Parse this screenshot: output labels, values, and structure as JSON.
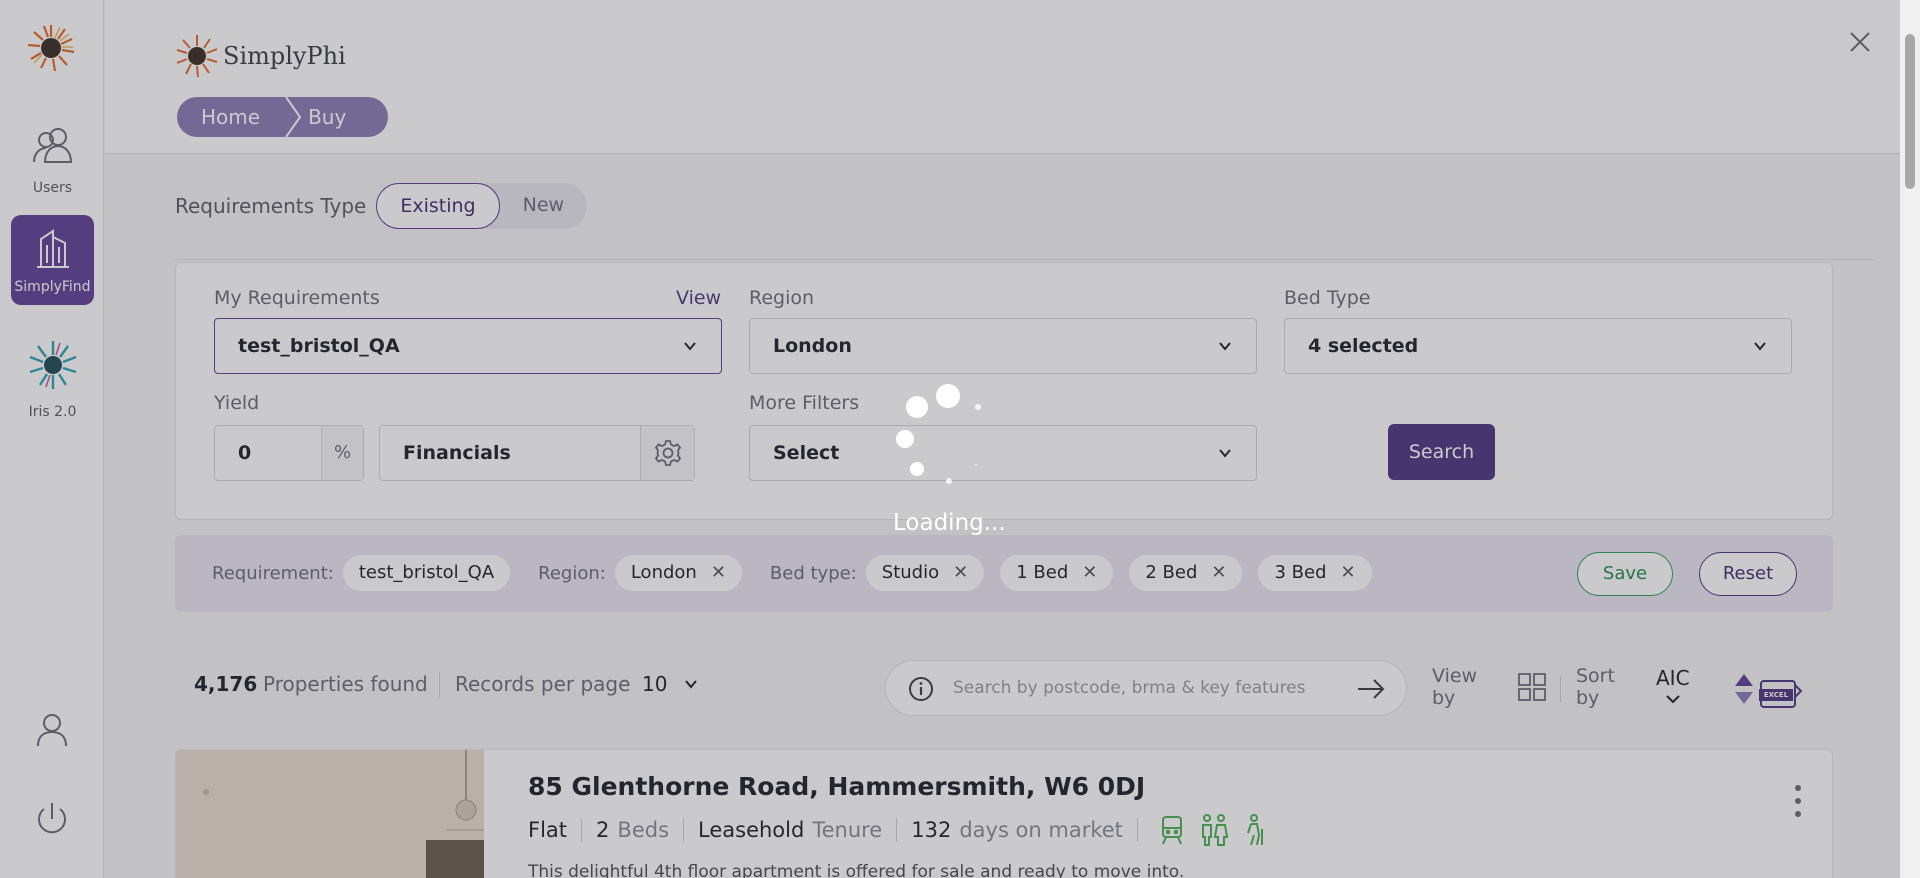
{
  "sidebar": {
    "items": [
      {
        "label": "Users"
      },
      {
        "label": "SimplyFind"
      },
      {
        "label": "Iris 2.0"
      }
    ]
  },
  "header": {
    "brand": "SimplyPhi",
    "breadcrumb": [
      "Home",
      "Buy"
    ]
  },
  "requirements_type": {
    "label": "Requirements Type",
    "options": [
      "Existing",
      "New"
    ],
    "selected": "Existing"
  },
  "filters": {
    "my_requirements": {
      "label": "My Requirements",
      "link": "View",
      "value": "test_bristol_QA"
    },
    "region": {
      "label": "Region",
      "value": "London"
    },
    "bed_type": {
      "label": "Bed Type",
      "value": "4 selected"
    },
    "yield": {
      "label": "Yield",
      "value": "0",
      "unit": "%"
    },
    "financials": {
      "label": "Financials"
    },
    "more_filters": {
      "label": "More Filters",
      "value": "Select"
    },
    "search_button": "Search"
  },
  "active_filters": {
    "requirement_label": "Requirement:",
    "requirement": "test_bristol_QA",
    "region_label": "Region:",
    "region": "London",
    "bed_type_label": "Bed type:",
    "bed_types": [
      "Studio",
      "1 Bed",
      "2 Bed",
      "3 Bed"
    ],
    "save": "Save",
    "reset": "Reset"
  },
  "results": {
    "count": "4,176",
    "count_label": "Properties found",
    "records_per_page_label": "Records per page",
    "records_per_page": "10",
    "search_placeholder": "Search by postcode, brma & key features",
    "view_by": "View by",
    "sort_by": "Sort by",
    "sort_value": "AIC",
    "excel_label": "EXCEL"
  },
  "property": {
    "title": "85 Glenthorne Road, Hammersmith, W6 0DJ",
    "type": "Flat",
    "beds": "2",
    "beds_label": "Beds",
    "tenure": "Leasehold",
    "tenure_label": "Tenure",
    "days": "132",
    "days_label": "days on market",
    "description": "This delightful 4th floor apartment is offered for sale and ready to move into."
  },
  "overlay": {
    "loading_text": "Loading..."
  },
  "colors": {
    "brand_purple": "#5e3f96",
    "save_green": "#1f8a4c",
    "amenity_green": "#4caf50"
  }
}
